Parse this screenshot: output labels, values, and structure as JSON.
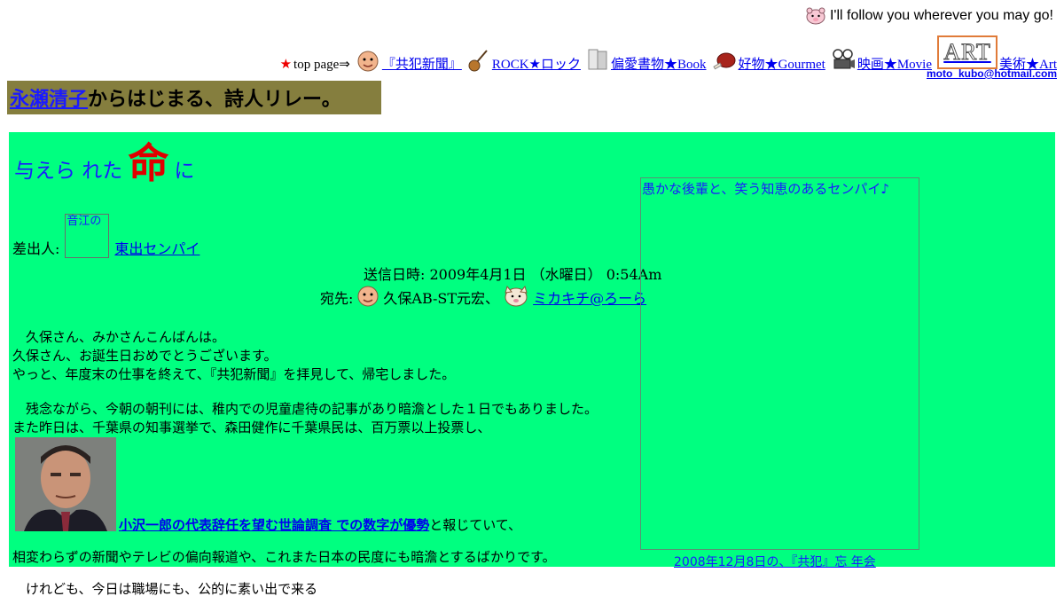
{
  "header": {
    "tagline": "I'll follow you wherever you may go!",
    "email": "moto_kubo@hotmail.com"
  },
  "nav": {
    "top_prefix": "top page⇒",
    "items": [
      {
        "label": "『共犯新聞』",
        "icon": "face-icon"
      },
      {
        "label": "ROCK★ロック",
        "icon": "guitar-icon"
      },
      {
        "label": "偏愛書物★Book",
        "icon": "book-icon"
      },
      {
        "label": "好物★Gourmet",
        "icon": "meat-icon"
      },
      {
        "label": "映画★Movie",
        "icon": "film-projector-icon"
      },
      {
        "label": "美術★Art",
        "icon": "art-logo-icon"
      }
    ],
    "art_logo_text": "ART"
  },
  "banner": {
    "link": "永瀬清子",
    "rest": "からはじまる、詩人リレー。"
  },
  "panel": {
    "headline_pre": "与えら れた ",
    "headline_big": "命",
    "headline_post": " に",
    "sender_label": "差出人:",
    "sender_img_alt": "音江の",
    "sender_name": "東出センパイ",
    "date": "送信日時: 2009年4月1日 （水曜日） 0:54Am",
    "to_label": "宛先:",
    "to_name1": "久保AB-ST元宏、",
    "to_name2": "ミカキチ@ろーら",
    "body_lines_1": [
      "　久保さん、みかさんこんばんは。",
      "久保さん、お誕生日おめでとうございます。",
      "やっと、年度末の仕事を終えて、『共犯新聞』を拝見して、帰宅しました。"
    ],
    "body_lines_2": [
      "　残念ながら、今朝の朝刊には、稚内での児童虐待の記事があり暗澹とした１日でもありました。",
      "また昨日は、千葉県の知事選挙で、森田健作に千葉県民は、百万票以上投票し、"
    ],
    "photo_link": "小沢一郎の代表辞任を望む世論調査 での数字が優勢",
    "photo_link_suffix": "と報じていて、",
    "body_lines_3": [
      "相変わらずの新聞やテレビの偏向報道や、これまた日本の民度にも暗澹とするばかりです。",
      "　けれども、今日は職場にも、公的に素い出で来る"
    ],
    "side_img_alt": "愚かな後輩と、笑う知恵のあるセンパイ♪",
    "side_caption": "2008年12月8日の、『共犯』忘 年会"
  }
}
